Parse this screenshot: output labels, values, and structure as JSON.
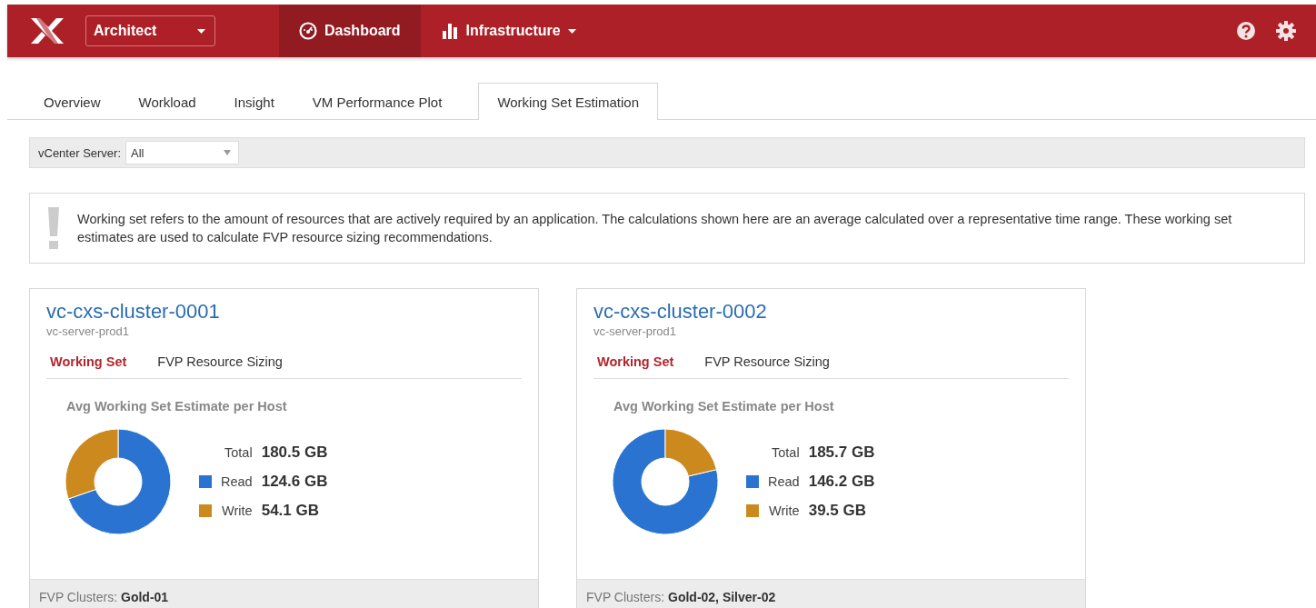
{
  "header": {
    "product": "Architect",
    "nav": [
      {
        "label": "Dashboard",
        "kind": "gauge",
        "selected": true
      },
      {
        "label": "Infrastructure",
        "kind": "bars",
        "selected": false
      }
    ]
  },
  "tabs": [
    {
      "label": "Overview",
      "selected": false
    },
    {
      "label": "Workload",
      "selected": false
    },
    {
      "label": "Insight",
      "selected": false
    },
    {
      "label": "VM Performance Plot",
      "selected": false
    },
    {
      "label": "Working Set Estimation",
      "selected": true
    }
  ],
  "filter": {
    "label": "vCenter Server:",
    "value": "All"
  },
  "notice": "Working set refers to the amount of resources that are actively required by an application. The calculations shown here are an average calculated over a representative time range. These working set estimates are used to calculate FVP resource sizing recommendations.",
  "clusters": [
    {
      "name": "vc-cxs-cluster-0001",
      "server": "vc-server-prod1",
      "tabs": [
        {
          "label": "Working Set",
          "selected": true
        },
        {
          "label": "FVP Resource Sizing",
          "selected": false
        }
      ],
      "chart_title": "Avg Working Set Estimate per Host",
      "chart_data": {
        "type": "donut",
        "categories": [
          "Read",
          "Write"
        ],
        "values": [
          69.7,
          30.3
        ],
        "colors": [
          "#2b73d0",
          "#cc8a1e"
        ],
        "orientation": "clockwise"
      },
      "total_label": "Total",
      "total": "180.5 GB",
      "legend": [
        {
          "value": "124.6 GB",
          "color": "#2b73d0"
        },
        {
          "value": "54.1 GB",
          "color": "#cc8a1e"
        }
      ],
      "footer": "FVP Clusters: **Gold-01**"
    },
    {
      "name": "vc-cxs-cluster-0002",
      "server": "vc-server-prod1",
      "tabs": [
        {
          "label": "Working Set",
          "selected": true
        },
        {
          "label": "FVP Resource Sizing",
          "selected": false
        }
      ],
      "chart_title": "Avg Working Set Estimate per Host",
      "chart_data": {
        "type": "donut",
        "categories": [
          "Read",
          "Write"
        ],
        "values": [
          78.7,
          21.3
        ],
        "colors": [
          "#2b73d0",
          "#cc8a1e"
        ],
        "orientation": "counterclockwise"
      },
      "total_label": "Total",
      "total": "185.7 GB",
      "legend": [
        {
          "value": "146.2 GB",
          "color": "#2b73d0"
        },
        {
          "value": "39.5 GB",
          "color": "#cc8a1e"
        }
      ],
      "footer": "FVP Clusters: **Gold-02, Silver-02**"
    }
  ]
}
